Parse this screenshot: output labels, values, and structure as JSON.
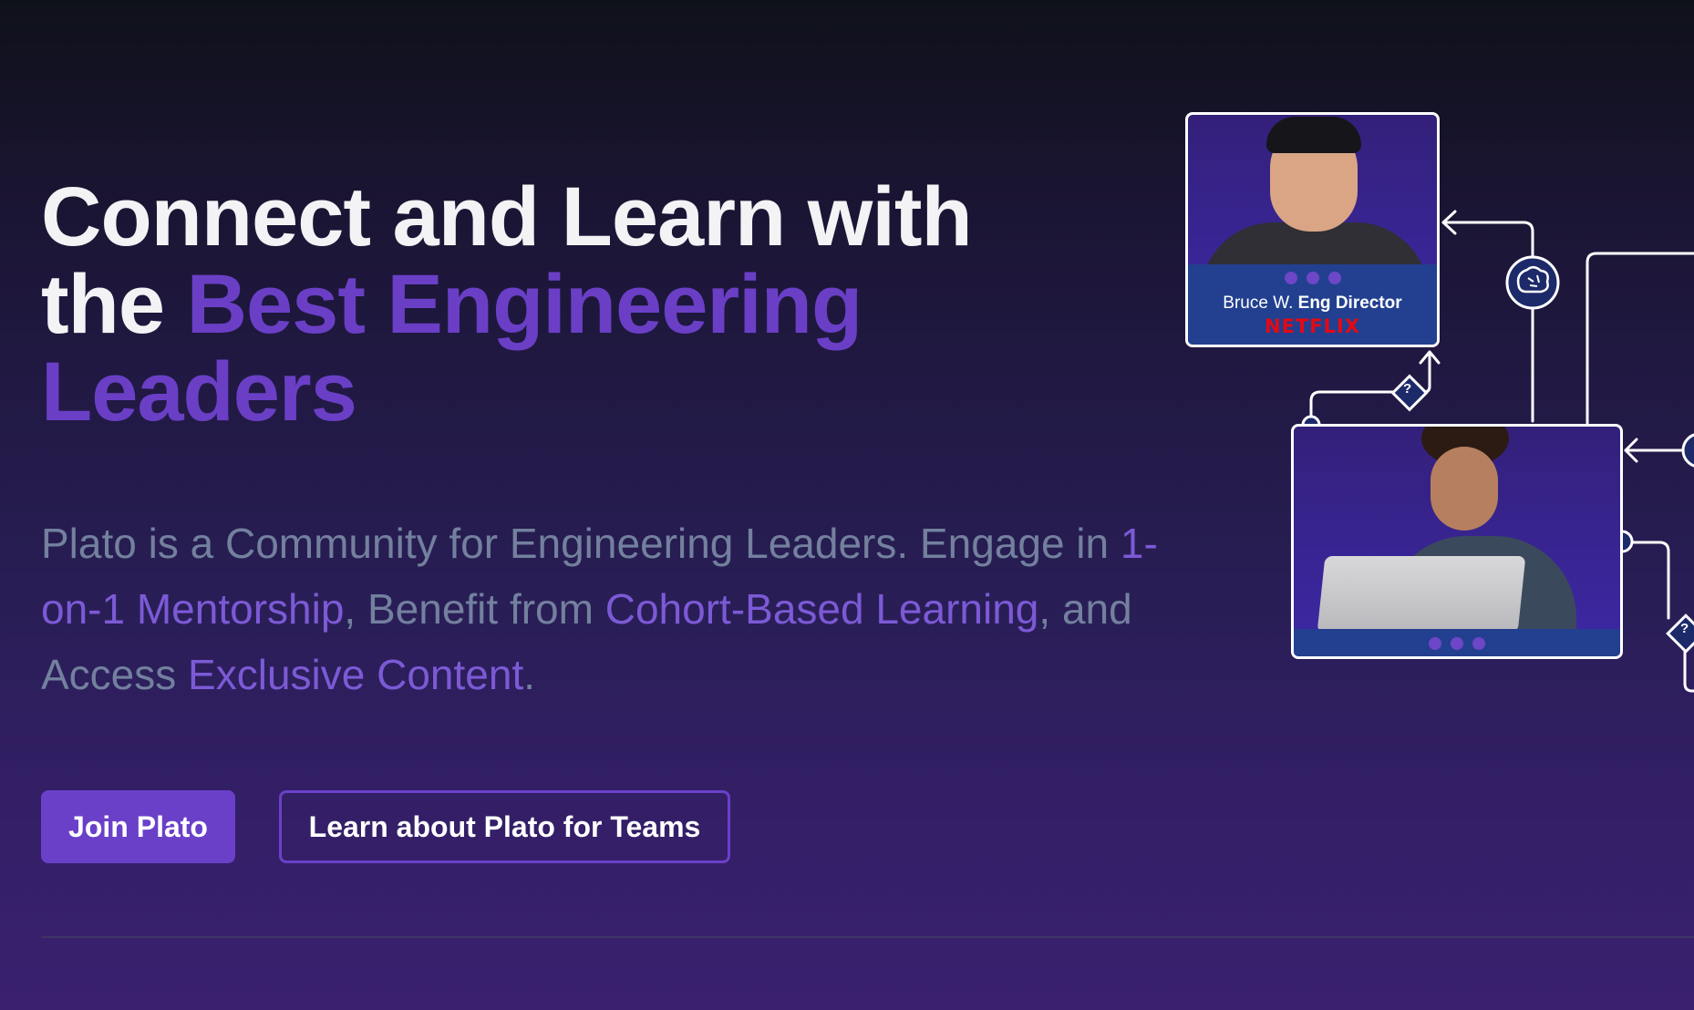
{
  "hero": {
    "title_line1": "Connect and Learn with",
    "title_the": "the",
    "title_accent_1": "Best Engineering",
    "title_accent_2": "Leaders"
  },
  "description": {
    "part1": "Plato is a Community for Engineering Leaders. Engage in ",
    "hl1": "1-on-1 Mentorship",
    "part2": ", Benefit from ",
    "hl2": "Cohort-Based Learning",
    "part3": ", and Access ",
    "hl3": "Exclusive Content",
    "part4": "."
  },
  "buttons": {
    "primary_label": "Join Plato",
    "secondary_label": "Learn about Plato for Teams"
  },
  "illustration": {
    "card_bruce": {
      "name": "Bruce W.",
      "role": "Eng Director",
      "company": "NETFLIX"
    },
    "question_mark": "?",
    "icons": {
      "brain": "brain-icon",
      "question": "question-diamond-icon"
    }
  },
  "colors": {
    "accent": "#6a3fc6",
    "button": "#6a40c9",
    "description_text": "#73809e",
    "description_highlight": "#7c5ad6",
    "card_bar": "#22408f",
    "netflix_red": "#e50914"
  }
}
